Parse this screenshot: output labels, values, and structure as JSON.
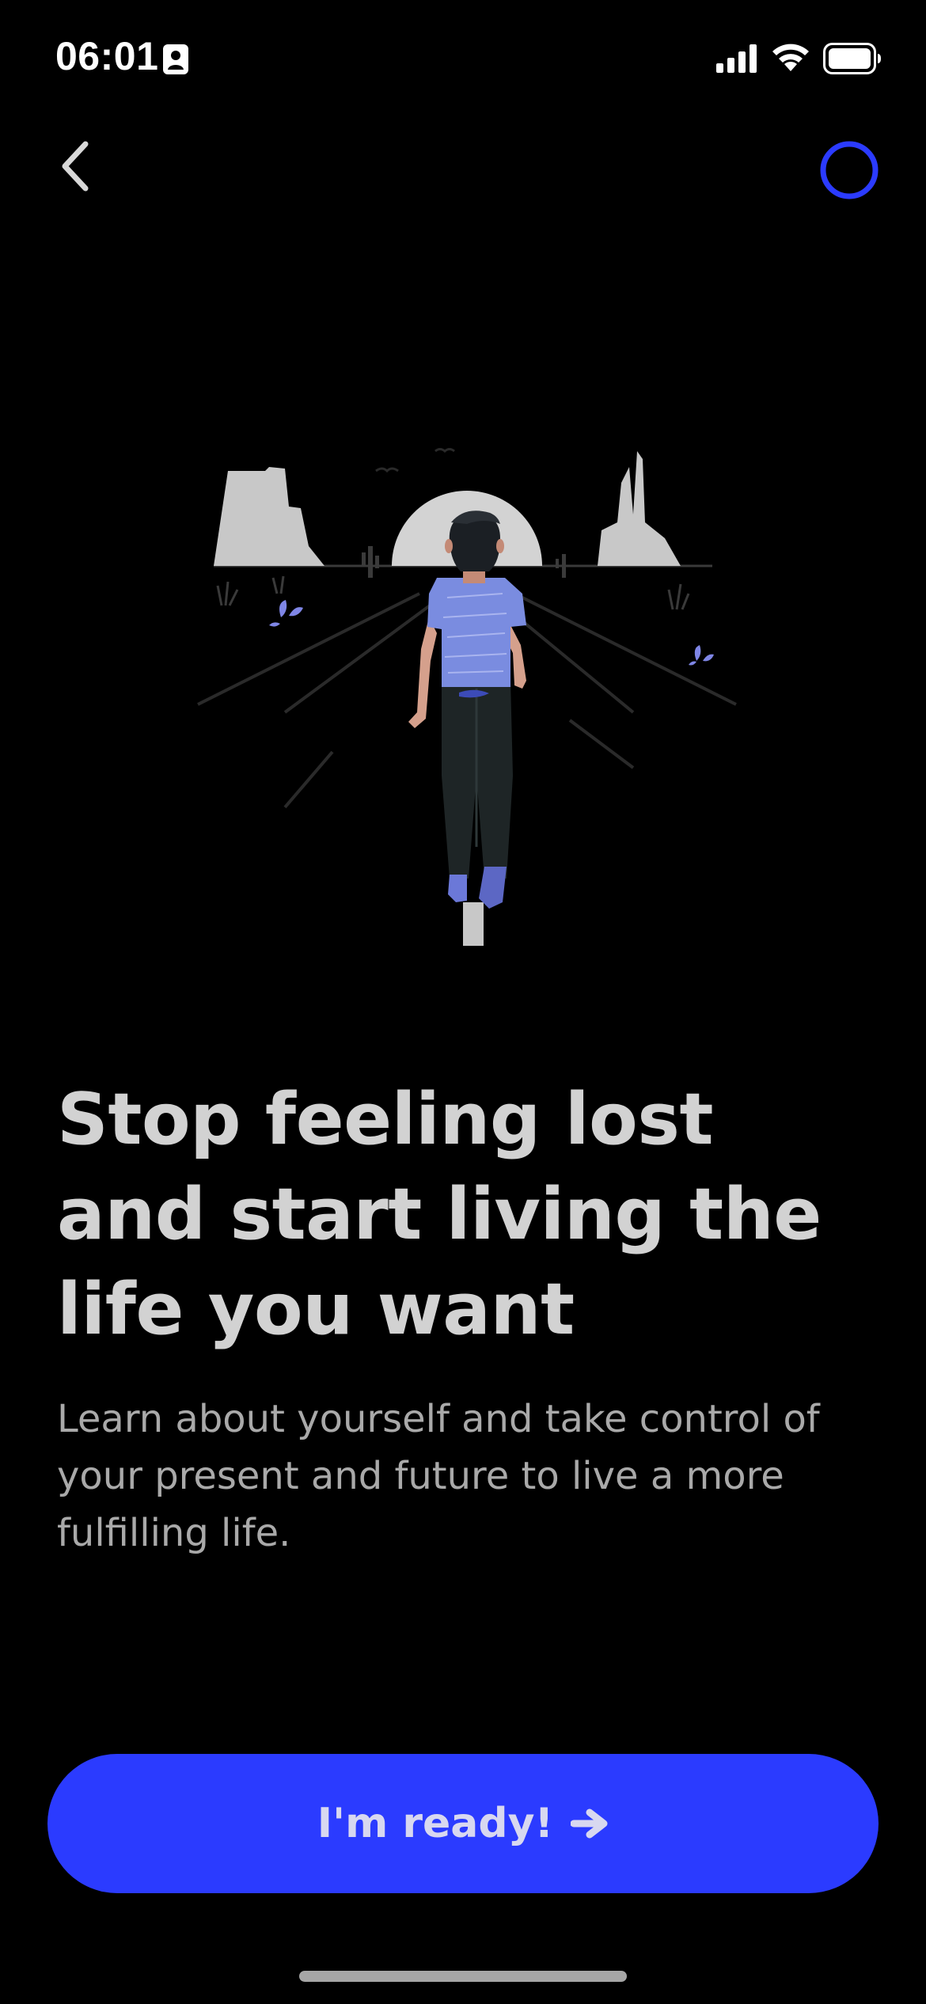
{
  "status_bar": {
    "time": "06:01"
  },
  "onboarding": {
    "headline": "Stop feeling lost and start living the life you want",
    "subtitle": "Learn about yourself and take control of your present and future to live a more fulfilling life.",
    "cta_label": "I'm ready!"
  },
  "colors": {
    "background": "#000000",
    "accent": "#2b3bff",
    "headline_text": "#d2d2d2",
    "subtitle_text": "#a9a9a9"
  },
  "icons": {
    "back": "chevron-left-icon",
    "progress": "progress-ring-icon",
    "cta": "arrow-right-icon"
  }
}
